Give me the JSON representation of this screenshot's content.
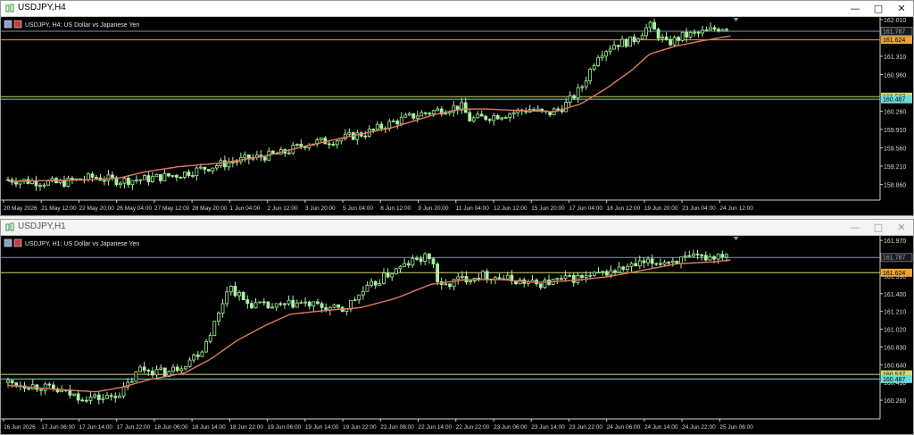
{
  "colors": {
    "bull": "#a8f0a0",
    "bear": "#a8f0a0",
    "ma": "#e07a5f",
    "orange_line": "#e8a33a",
    "yellow_line": "#d8d86a",
    "cyan_line": "#6ed8d8",
    "grey_line": "#8a94a8",
    "axis_text": "#d8d8d8"
  },
  "icons": {
    "chart": "chart-icon",
    "minimize": "minimize-icon",
    "maximize": "maximize-icon",
    "close": "close-icon"
  },
  "windows": [
    {
      "title": "USDJPY,H4",
      "info": "USDJPY, H4:  US Dollar vs Japanese Yen",
      "y_min": 158.56,
      "y_max": 162.01,
      "ticks": [
        "162.010",
        "161.310",
        "160.960",
        "160.260",
        "159.910",
        "159.560",
        "159.210",
        "158.860"
      ],
      "tick_values": [
        162.01,
        161.31,
        160.96,
        160.26,
        159.91,
        159.56,
        159.21,
        158.86
      ],
      "price_labels": [
        {
          "text": "161.787",
          "value": 161.787,
          "kind": "grey"
        },
        {
          "text": "161.624",
          "value": 161.624,
          "kind": "orange"
        },
        {
          "text": "160.537",
          "value": 160.537,
          "kind": "yellow"
        },
        {
          "text": "160.487",
          "value": 160.487,
          "kind": "cyan"
        }
      ],
      "xlabels": [
        "20 May 2026",
        "21 May 12:00",
        "22 May 20:00",
        "26 May 04:00",
        "27 May 12:00",
        "28 May 20:00",
        "1 Jun 04:00",
        "2 Jun 12:00",
        "3 Jun 20:00",
        "5 Jun 04:00",
        "8 Jun 12:00",
        "9 Jun 20:00",
        "11 Jun 04:00",
        "12 Jun 12:00",
        "15 Jun 20:00",
        "17 Jun 04:00",
        "18 Jun 12:00",
        "19 Jun 20:00",
        "23 Jun 04:00",
        "24 Jun 12:00"
      ],
      "path": [
        [
          0,
          158.95
        ],
        [
          0.06,
          158.88
        ],
        [
          0.1,
          159.0
        ],
        [
          0.13,
          158.93
        ],
        [
          0.16,
          158.96
        ],
        [
          0.2,
          159.05
        ],
        [
          0.25,
          159.25
        ],
        [
          0.28,
          159.35
        ],
        [
          0.32,
          159.45
        ],
        [
          0.35,
          159.65
        ],
        [
          0.38,
          159.7
        ],
        [
          0.42,
          159.85
        ],
        [
          0.45,
          160.05
        ],
        [
          0.48,
          160.2
        ],
        [
          0.51,
          160.3
        ],
        [
          0.53,
          160.35
        ],
        [
          0.54,
          160.1
        ],
        [
          0.56,
          160.15
        ],
        [
          0.58,
          160.2
        ],
        [
          0.61,
          160.3
        ],
        [
          0.63,
          160.2
        ],
        [
          0.65,
          160.35
        ],
        [
          0.67,
          160.7
        ],
        [
          0.69,
          161.35
        ],
        [
          0.71,
          161.55
        ],
        [
          0.73,
          161.6
        ],
        [
          0.75,
          161.9
        ],
        [
          0.77,
          161.55
        ],
        [
          0.79,
          161.7
        ],
        [
          0.81,
          161.75
        ],
        [
          0.83,
          161.85
        ],
        [
          0.845,
          161.9
        ]
      ],
      "ma": [
        [
          0,
          158.92
        ],
        [
          0.1,
          158.95
        ],
        [
          0.13,
          158.98
        ],
        [
          0.16,
          159.1
        ],
        [
          0.2,
          159.2
        ],
        [
          0.25,
          159.27
        ],
        [
          0.3,
          159.4
        ],
        [
          0.35,
          159.6
        ],
        [
          0.4,
          159.78
        ],
        [
          0.45,
          159.95
        ],
        [
          0.5,
          160.2
        ],
        [
          0.53,
          160.3
        ],
        [
          0.56,
          160.3
        ],
        [
          0.6,
          160.27
        ],
        [
          0.64,
          160.25
        ],
        [
          0.67,
          160.4
        ],
        [
          0.7,
          160.7
        ],
        [
          0.73,
          161.05
        ],
        [
          0.75,
          161.35
        ],
        [
          0.78,
          161.5
        ],
        [
          0.81,
          161.6
        ],
        [
          0.845,
          161.7
        ]
      ],
      "hlines": [
        {
          "value": 161.787,
          "kind": "grey"
        },
        {
          "value": 161.624,
          "kind": "orange"
        },
        {
          "value": 160.537,
          "kind": "yellow"
        },
        {
          "value": 160.487,
          "kind": "cyan"
        }
      ],
      "n_candles": 180,
      "seed": 7
    },
    {
      "title": "USDJPY,H1",
      "info": "USDJPY, H1:  US Dollar vs Japanese Yen",
      "y_min": 160.06,
      "y_max": 161.99,
      "ticks": [
        "161.970",
        "161.590",
        "161.400",
        "161.210",
        "161.020",
        "160.830",
        "160.640",
        "160.450",
        "160.260"
      ],
      "tick_values": [
        161.97,
        161.59,
        161.4,
        161.21,
        161.02,
        160.83,
        160.64,
        160.45,
        160.26
      ],
      "price_labels": [
        {
          "text": "161.787",
          "value": 161.787,
          "kind": "grey"
        },
        {
          "text": "161.624",
          "value": 161.624,
          "kind": "orange"
        },
        {
          "text": "160.537",
          "value": 160.537,
          "kind": "yellow"
        },
        {
          "text": "160.487",
          "value": 160.487,
          "kind": "cyan"
        }
      ],
      "xlabels": [
        "16 Jun 2026",
        "17 Jun 06:00",
        "17 Jun 14:00",
        "17 Jun 22:00",
        "18 Jun 06:00",
        "18 Jun 14:00",
        "18 Jun 22:00",
        "19 Jun 06:00",
        "19 Jun 14:00",
        "19 Jun 22:00",
        "22 Jun 06:00",
        "22 Jun 14:00",
        "22 Jun 22:00",
        "23 Jun 06:00",
        "23 Jun 14:00",
        "23 Jun 22:00",
        "24 Jun 06:00",
        "24 Jun 14:00",
        "24 Jun 22:00",
        "25 Jun 06:00"
      ],
      "path": [
        [
          0,
          160.45
        ],
        [
          0.04,
          160.4
        ],
        [
          0.08,
          160.3
        ],
        [
          0.11,
          160.28
        ],
        [
          0.13,
          160.35
        ],
        [
          0.15,
          160.6
        ],
        [
          0.18,
          160.55
        ],
        [
          0.2,
          160.65
        ],
        [
          0.22,
          160.8
        ],
        [
          0.24,
          161.2
        ],
        [
          0.25,
          161.5
        ],
        [
          0.27,
          161.3
        ],
        [
          0.3,
          161.25
        ],
        [
          0.33,
          161.3
        ],
        [
          0.36,
          161.25
        ],
        [
          0.38,
          161.22
        ],
        [
          0.4,
          161.4
        ],
        [
          0.43,
          161.6
        ],
        [
          0.46,
          161.75
        ],
        [
          0.48,
          161.8
        ],
        [
          0.49,
          161.45
        ],
        [
          0.51,
          161.55
        ],
        [
          0.54,
          161.6
        ],
        [
          0.57,
          161.55
        ],
        [
          0.6,
          161.5
        ],
        [
          0.63,
          161.55
        ],
        [
          0.66,
          161.58
        ],
        [
          0.69,
          161.65
        ],
        [
          0.72,
          161.72
        ],
        [
          0.75,
          161.75
        ],
        [
          0.78,
          161.78
        ],
        [
          0.8,
          161.8
        ],
        [
          0.82,
          161.85
        ]
      ],
      "ma": [
        [
          0,
          160.42
        ],
        [
          0.05,
          160.38
        ],
        [
          0.1,
          160.35
        ],
        [
          0.13,
          160.4
        ],
        [
          0.16,
          160.48
        ],
        [
          0.2,
          160.55
        ],
        [
          0.23,
          160.7
        ],
        [
          0.26,
          160.9
        ],
        [
          0.29,
          161.05
        ],
        [
          0.32,
          161.18
        ],
        [
          0.36,
          161.22
        ],
        [
          0.4,
          161.25
        ],
        [
          0.44,
          161.35
        ],
        [
          0.48,
          161.5
        ],
        [
          0.52,
          161.55
        ],
        [
          0.56,
          161.55
        ],
        [
          0.6,
          161.52
        ],
        [
          0.64,
          161.54
        ],
        [
          0.68,
          161.58
        ],
        [
          0.72,
          161.65
        ],
        [
          0.76,
          161.72
        ],
        [
          0.8,
          161.74
        ],
        [
          0.82,
          161.76
        ]
      ],
      "hlines": [
        {
          "value": 161.787,
          "kind": "grey"
        },
        {
          "value": 161.624,
          "kind": "yellow"
        },
        {
          "value": 160.537,
          "kind": "yellow"
        },
        {
          "value": 160.487,
          "kind": "cyan"
        }
      ],
      "n_candles": 175,
      "seed": 13
    }
  ]
}
